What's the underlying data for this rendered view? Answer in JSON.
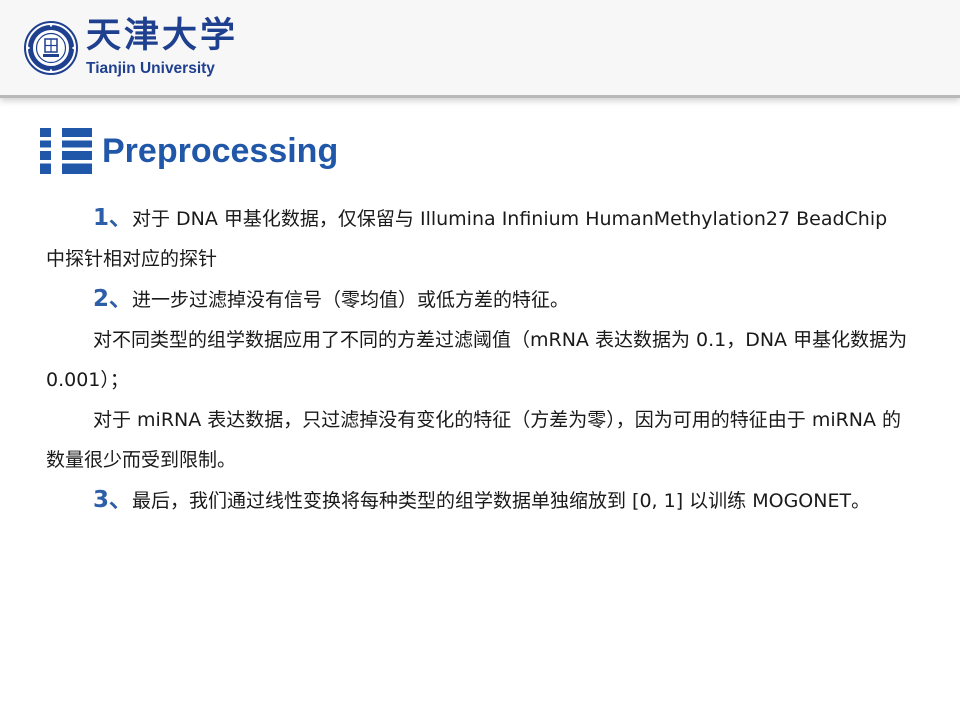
{
  "header": {
    "logo_cn": "天津大学",
    "logo_en": "Tianjin University",
    "logo_icon": "university-seal-icon"
  },
  "slide": {
    "title": "Preprocessing",
    "title_icon": "finnish-cross-icon",
    "accent_color": "#2157a8"
  },
  "paragraphs": [
    {
      "num": "1、",
      "text": "对于 DNA 甲基化数据，仅保留与 Illumina Infinium HumanMethylation27 BeadChip 中探针相对应的探针"
    },
    {
      "num": "2、",
      "text": "进一步过滤掉没有信号（零均值）或低方差的特征。"
    },
    {
      "num": "",
      "text": "对不同类型的组学数据应用了不同的方差过滤阈值（mRNA 表达数据为 0.1，DNA 甲基化数据为 0.001）；"
    },
    {
      "num": "",
      "text": "对于 miRNA 表达数据，只过滤掉没有变化的特征（方差为零），因为可用的特征由于 miRNA 的数量很少而受到限制。"
    },
    {
      "num": "3、",
      "text": "最后，我们通过线性变换将每种类型的组学数据单独缩放到 [0, 1] 以训练 MOGONET。"
    }
  ]
}
